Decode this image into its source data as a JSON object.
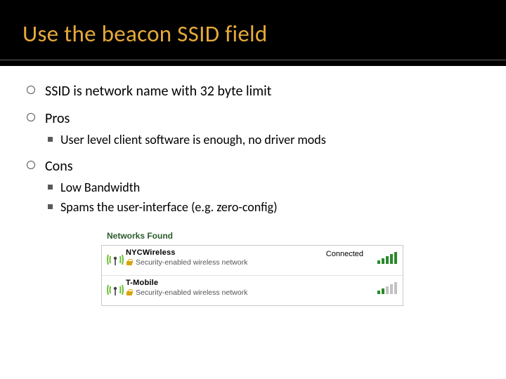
{
  "title": "Use the beacon SSID field",
  "bullets": {
    "b1": "SSID is network name with 32 byte limit",
    "b2": "Pros",
    "b2_1": "User level client software is enough, no driver mods",
    "b3": "Cons",
    "b3_1": "Low Bandwidth",
    "b3_2": "Spams the user-interface (e.g. zero-config)"
  },
  "networks": {
    "header": "Networks Found",
    "n1": {
      "ssid": "NYCWireless",
      "sub": "Security-enabled wireless network",
      "status": "Connected"
    },
    "n2": {
      "ssid": "T-Mobile",
      "sub": "Security-enabled wireless network"
    }
  }
}
